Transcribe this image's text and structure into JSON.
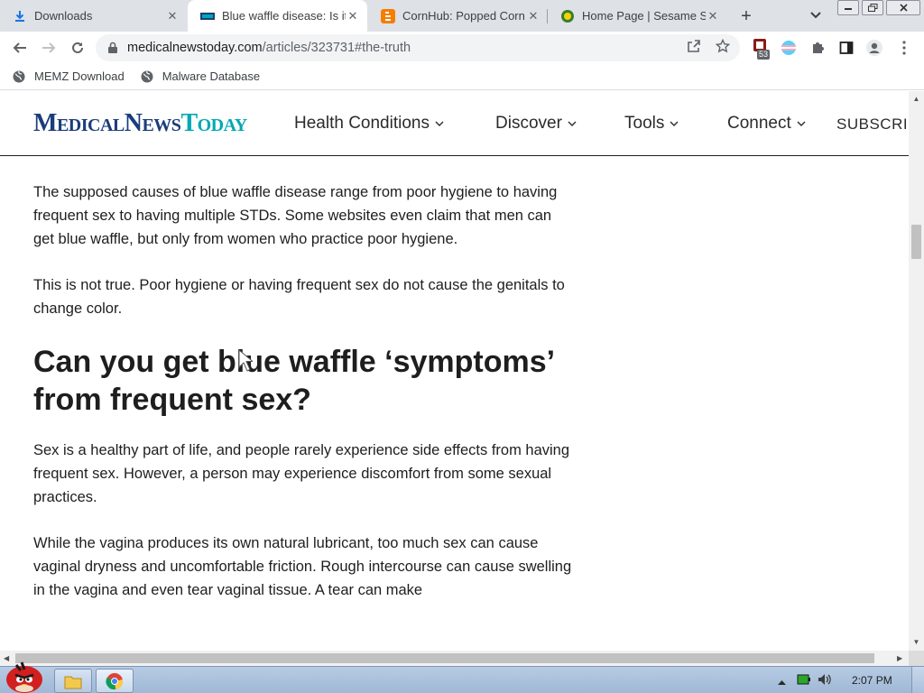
{
  "browser": {
    "tabs": [
      {
        "title": "Downloads",
        "icon": "download-icon",
        "active": false
      },
      {
        "title": "Blue waffle disease: Is it",
        "icon": "mnt-favicon",
        "active": true
      },
      {
        "title": "CornHub: Popped Corn",
        "icon": "blogger-icon",
        "active": false
      },
      {
        "title": "Home Page | Sesame St",
        "icon": "sesame-icon",
        "active": false
      }
    ],
    "new_tab_label": "+",
    "address": {
      "host": "medicalnewstoday.com",
      "path": "/articles/323731#the-truth"
    },
    "extension_badge": "53",
    "bookmarks": [
      {
        "label": "MEMZ Download"
      },
      {
        "label": "Malware Database"
      }
    ]
  },
  "site": {
    "logo": {
      "m": "M",
      "edical": "EDICAL",
      "n": "N",
      "ews": "EWS",
      "t": "T",
      "oday": "ODAY"
    },
    "nav": [
      {
        "label": "Health Conditions"
      },
      {
        "label": "Discover"
      },
      {
        "label": "Tools"
      },
      {
        "label": "Connect"
      }
    ],
    "subscribe": "SUBSCRIBE"
  },
  "article": {
    "p1": "The supposed causes of blue waffle disease range from poor hygiene to having frequent sex to having multiple STDs. Some websites even claim that men can get blue waffle, but only from women who practice poor hygiene.",
    "p2": "This is not true. Poor hygiene or having frequent sex do not cause the genitals to change color.",
    "heading": "Can you get blue waffle ‘symptoms’ from frequent sex?",
    "p3": "Sex is a healthy part of life, and people rarely experience side effects from having frequent sex. However, a person may experience discomfort from some sexual practices.",
    "p4": "While the vagina produces its own natural lubricant, too much sex can cause vaginal dryness and uncomfortable friction. Rough intercourse can cause swelling in the vagina and even tear vaginal tissue. A tear can make"
  },
  "taskbar": {
    "clock": "2:07 PM"
  },
  "colors": {
    "logo_navy": "#1b3d7a",
    "logo_teal": "#00a9b4",
    "tabstrip": "#dee1e6"
  }
}
